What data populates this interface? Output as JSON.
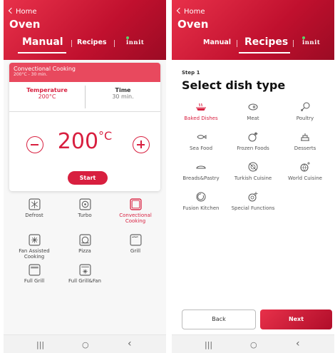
{
  "manual_screen": {
    "home_link": "Home",
    "title": "Oven",
    "tabs": {
      "manual": "Manual",
      "recipes": "Recipes",
      "brand": "innit"
    },
    "card": {
      "mode_name": "Convectional Cooking",
      "mode_summary": "200°C - 30 min.",
      "temperature_label": "Temperature",
      "temperature_value": "200°C",
      "time_label": "Time",
      "time_value": "30 min.",
      "big_value": "200",
      "big_unit": "°C",
      "start_label": "Start"
    },
    "functions": [
      {
        "label": "Defrost",
        "icon": "defrost-icon",
        "selected": false
      },
      {
        "label": "Turbo",
        "icon": "turbo-icon",
        "selected": false
      },
      {
        "label": "Convectional Cooking",
        "icon": "convectional-icon",
        "selected": true
      },
      {
        "label": "Fan Assisted Cooking",
        "icon": "fan-assisted-icon",
        "selected": false
      },
      {
        "label": "Pizza",
        "icon": "pizza-icon",
        "selected": false
      },
      {
        "label": "Grill",
        "icon": "grill-icon",
        "selected": false
      },
      {
        "label": "Full Grill",
        "icon": "full-grill-icon",
        "selected": false
      },
      {
        "label": "Full Grill&Fan",
        "icon": "full-grill-fan-icon",
        "selected": false
      }
    ]
  },
  "recipes_screen": {
    "home_link": "Home",
    "title": "Oven",
    "tabs": {
      "manual": "Manual",
      "recipes": "Recipes",
      "brand": "innit"
    },
    "step_label": "Step 1",
    "heading": "Select dish type",
    "dish_types": [
      {
        "label": "Baked Dishes",
        "icon": "baked-dish-icon",
        "selected": true
      },
      {
        "label": "Meat",
        "icon": "meat-icon",
        "selected": false
      },
      {
        "label": "Poultry",
        "icon": "poultry-icon",
        "selected": false
      },
      {
        "label": "Sea Food",
        "icon": "fish-icon",
        "selected": false
      },
      {
        "label": "Frozen Foods",
        "icon": "frozen-icon",
        "selected": false
      },
      {
        "label": "Desserts",
        "icon": "dessert-icon",
        "selected": false
      },
      {
        "label": "Breads&Pastry",
        "icon": "bread-icon",
        "selected": false
      },
      {
        "label": "Turkish Cuisine",
        "icon": "turkish-cuisine-icon",
        "selected": false
      },
      {
        "label": "World Cuisine",
        "icon": "world-cuisine-icon",
        "selected": false
      },
      {
        "label": "Fusion Kitchen",
        "icon": "fusion-icon",
        "selected": false
      },
      {
        "label": "Special Functions",
        "icon": "special-functions-icon",
        "selected": false
      }
    ],
    "back_label": "Back",
    "next_label": "Next"
  },
  "navbar": {
    "recents": "|||",
    "home": "○",
    "back": "‹"
  },
  "colors": {
    "brand_red": "#d81f3f",
    "header_dark": "#9b0b24",
    "card_header": "#e8495e",
    "innit_dot": "#5dd36b"
  }
}
